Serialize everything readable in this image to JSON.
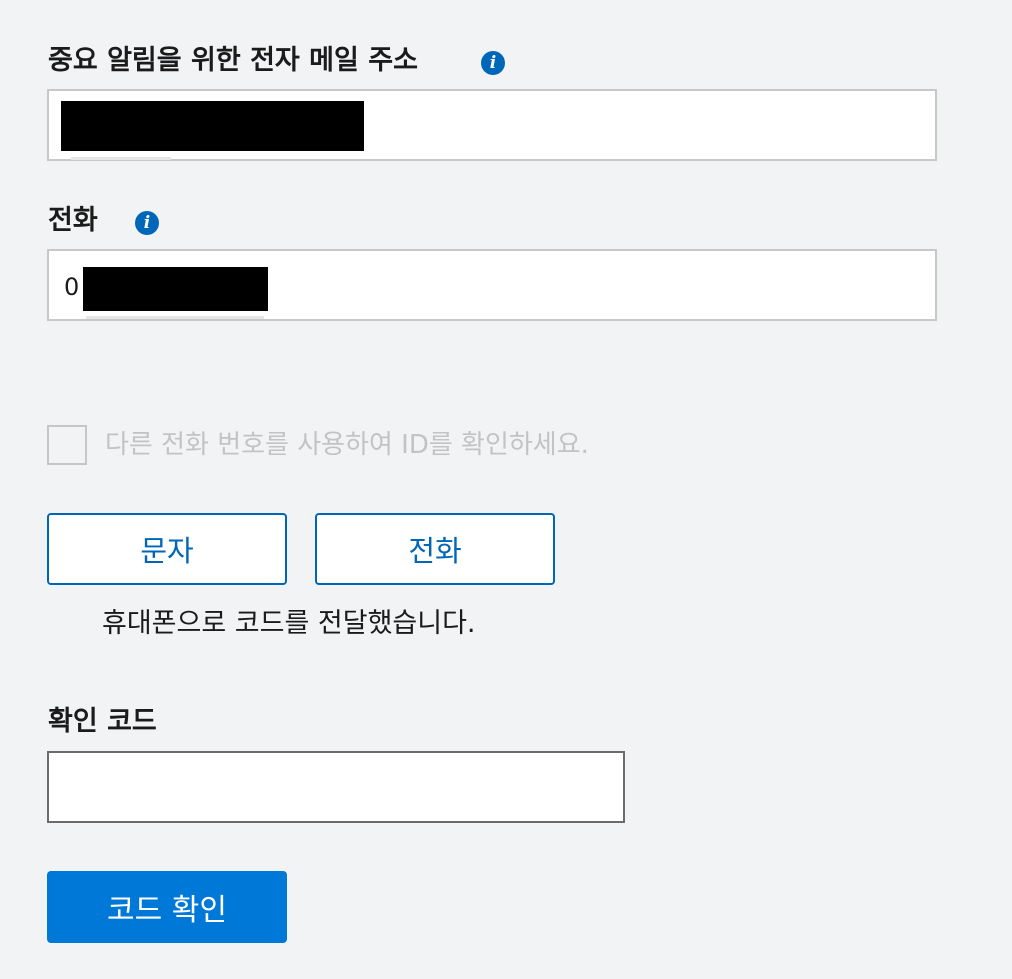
{
  "email": {
    "label": "중요 알림을 위한 전자 메일 주소",
    "info_icon": "info-icon",
    "value": ""
  },
  "phone": {
    "label": "전화",
    "info_icon": "info-icon",
    "value_prefix": "0"
  },
  "alt_phone_checkbox": {
    "label": "다른 전화 번호를 사용하여 ID를 확인하세요.",
    "checked": false
  },
  "method_buttons": {
    "text_label": "문자",
    "call_label": "전화"
  },
  "status_message": "휴대폰으로 코드를 전달했습니다.",
  "verification": {
    "label": "확인 코드",
    "value": "",
    "submit_label": "코드 확인"
  },
  "colors": {
    "accent": "#0078d7",
    "link": "#0067b8",
    "background": "#f2f3f5"
  }
}
